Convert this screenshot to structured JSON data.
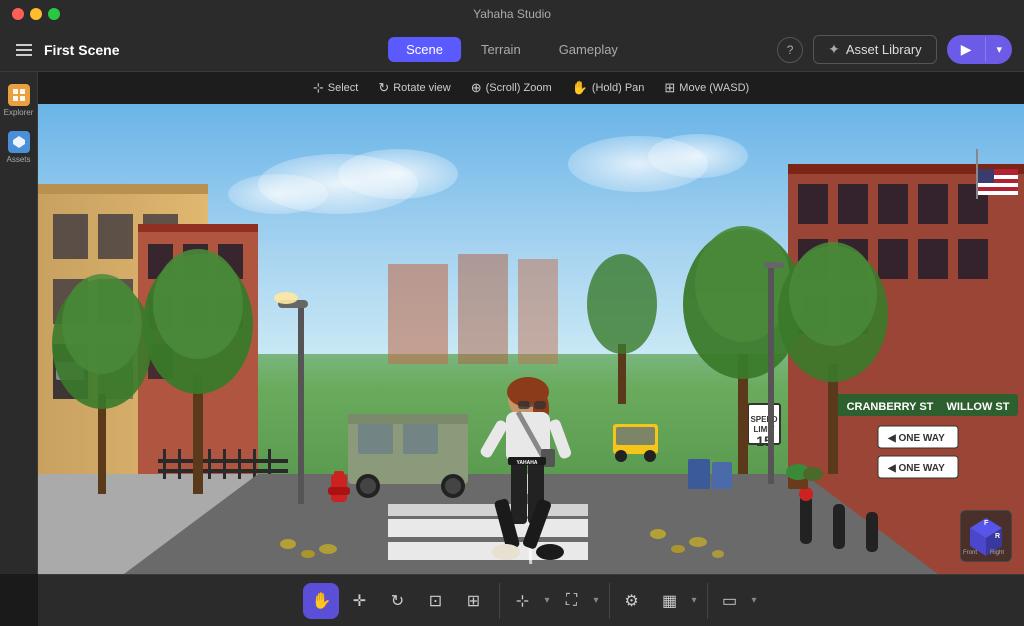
{
  "app": {
    "title": "Yahaha Studio"
  },
  "titlebar": {
    "title": "Yahaha Studio"
  },
  "toolbar": {
    "scene_title": "First Scene",
    "tabs": [
      {
        "id": "scene",
        "label": "Scene",
        "active": true
      },
      {
        "id": "terrain",
        "label": "Terrain",
        "active": false
      },
      {
        "id": "gameplay",
        "label": "Gameplay",
        "active": false
      }
    ],
    "help_label": "?",
    "asset_library_label": "Asset Library",
    "play_icon": "▶",
    "dropdown_icon": "▾"
  },
  "sidebar": {
    "items": [
      {
        "id": "explorer",
        "label": "Explorer",
        "icon": "🗂"
      },
      {
        "id": "assets",
        "label": "Assets",
        "icon": "📦"
      }
    ]
  },
  "tools_bar": {
    "tools": [
      {
        "id": "select",
        "icon": "⊹",
        "label": "Select"
      },
      {
        "id": "rotate",
        "icon": "↻",
        "label": "Rotate view"
      },
      {
        "id": "zoom",
        "icon": "⊕",
        "label": "(Scroll) Zoom"
      },
      {
        "id": "pan",
        "icon": "✋",
        "label": "(Hold) Pan"
      },
      {
        "id": "move",
        "icon": "⊞",
        "label": "Move (WASD)"
      }
    ]
  },
  "bottom_toolbar": {
    "groups": [
      {
        "tools": [
          {
            "id": "hand",
            "icon": "✋",
            "active": true
          },
          {
            "id": "move",
            "icon": "✛",
            "active": false
          },
          {
            "id": "rotate",
            "icon": "↻",
            "active": false
          },
          {
            "id": "scale",
            "icon": "⊡",
            "active": false
          },
          {
            "id": "transform",
            "icon": "⊕",
            "active": false
          }
        ]
      },
      {
        "tools": [
          {
            "id": "anchor",
            "icon": "⊞",
            "active": false
          },
          {
            "id": "expand",
            "icon": "⛶",
            "active": false
          }
        ]
      },
      {
        "tools": [
          {
            "id": "settings",
            "icon": "⚙",
            "active": false
          },
          {
            "id": "grid",
            "icon": "▦",
            "active": false
          }
        ]
      },
      {
        "tools": [
          {
            "id": "screen",
            "icon": "▭",
            "active": false
          }
        ]
      }
    ]
  },
  "compass": {
    "front_label": "Front",
    "right_label": "Right"
  },
  "colors": {
    "accent_purple": "#6b5be6",
    "sidebar_bg": "#2b2b2b",
    "toolbar_bg": "#2b2b2b",
    "active_tab": "#5a5aff",
    "explorer_icon": "#e8a040",
    "assets_icon": "#4a90d9"
  }
}
